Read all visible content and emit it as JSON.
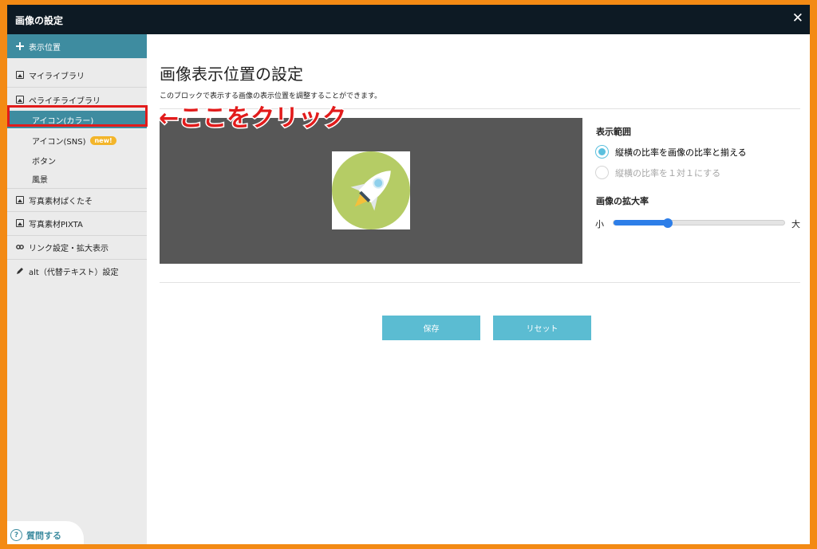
{
  "window": {
    "title": "画像の設定",
    "close_glyph": "✕"
  },
  "sidebar": {
    "items": [
      {
        "label": "表示位置",
        "icon": "move-icon"
      },
      {
        "label": "マイライブラリ",
        "icon": "image-icon"
      },
      {
        "label": "ペライチライブラリ",
        "icon": "image-icon"
      },
      {
        "label": "写真素材ぱくたそ",
        "icon": "image-icon"
      },
      {
        "label": "写真素材PIXTA",
        "icon": "image-icon"
      },
      {
        "label": "リンク設定・拡大表示",
        "icon": "link-icon"
      },
      {
        "label": "alt（代替テキスト）設定",
        "icon": "pencil-icon"
      }
    ],
    "subitems": [
      {
        "label": "アイコン(カラー)"
      },
      {
        "label": "アイコン(SNS)",
        "badge": "new!"
      },
      {
        "label": "ボタン"
      },
      {
        "label": "風景"
      }
    ],
    "help_label": "質問する"
  },
  "annotation": {
    "text": "←ここをクリック",
    "color": "#e21b1b"
  },
  "main": {
    "title": "画像表示位置の設定",
    "description": "このブロックで表示する画像の表示位置を調整することができます。",
    "range": {
      "heading": "表示範囲",
      "options": [
        {
          "label": "縦横の比率を画像の比率と揃える",
          "selected": true
        },
        {
          "label": "縦横の比率を１対１にする",
          "selected": false
        }
      ]
    },
    "zoom": {
      "heading": "画像の拡大率",
      "min_label": "小",
      "max_label": "大",
      "value_fraction": 0.32
    },
    "buttons": {
      "save": "保存",
      "reset": "リセット"
    }
  },
  "colors": {
    "accent": "#3e8ca0",
    "button": "#5bbcd2",
    "frame": "#f38a14",
    "titlebar": "#0d1a24",
    "slider": "#2d7ee8"
  }
}
